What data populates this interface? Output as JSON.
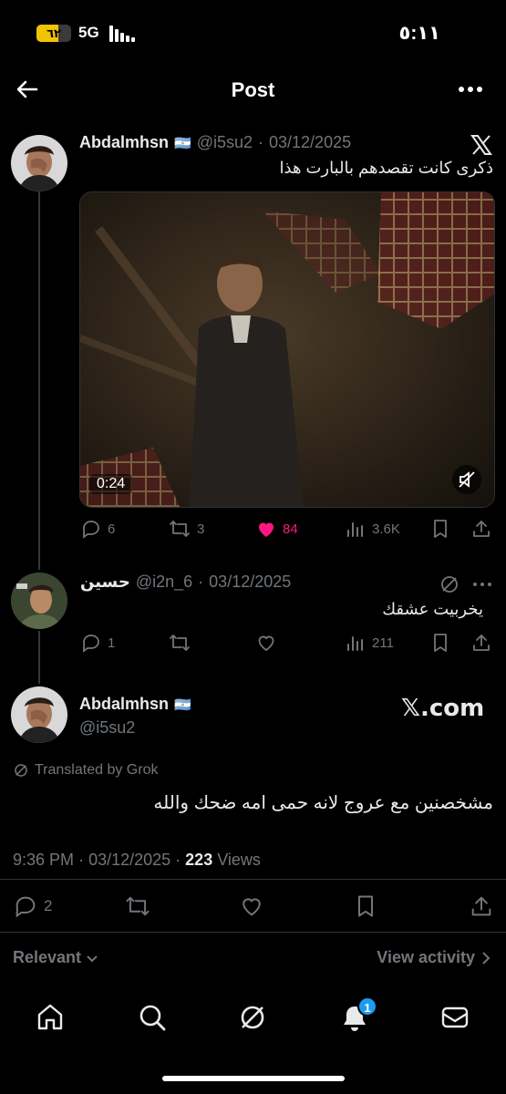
{
  "status_bar": {
    "battery": "٦٢",
    "battery_level": 0.62,
    "network": "5G",
    "time": "٥:١١"
  },
  "header": {
    "title": "Post"
  },
  "post1": {
    "name": "Abdalmhsn",
    "flag": "🇦🇷",
    "handle": "@i5su2",
    "date": "03/12/2025",
    "text": "ذكرى كانت تقصدهم بالبارت هذا",
    "video_time": "0:24",
    "replies": "6",
    "reposts": "3",
    "likes": "84",
    "views": "3.6K",
    "like_color": "#f91880"
  },
  "reply": {
    "name": "حسين",
    "handle": "@i2n_6",
    "date": "03/12/2025",
    "text": "يخربيت عشقك",
    "replies": "1",
    "views": "211"
  },
  "main_post": {
    "name": "Abdalmhsn",
    "flag": "🇦🇷",
    "handle": "@i5su2",
    "source": "𝕏.com",
    "translated_by": "Translated by Grok",
    "text": "مشخصنين مع عروج لانه حمى امه ضحك والله",
    "time": "9:36 PM",
    "date": "03/12/2025",
    "views_count": "223",
    "views_label": "Views",
    "replies": "2"
  },
  "footer": {
    "relevant": "Relevant",
    "view_activity": "View activity"
  },
  "bottom_nav": {
    "notifications_badge": "1"
  }
}
